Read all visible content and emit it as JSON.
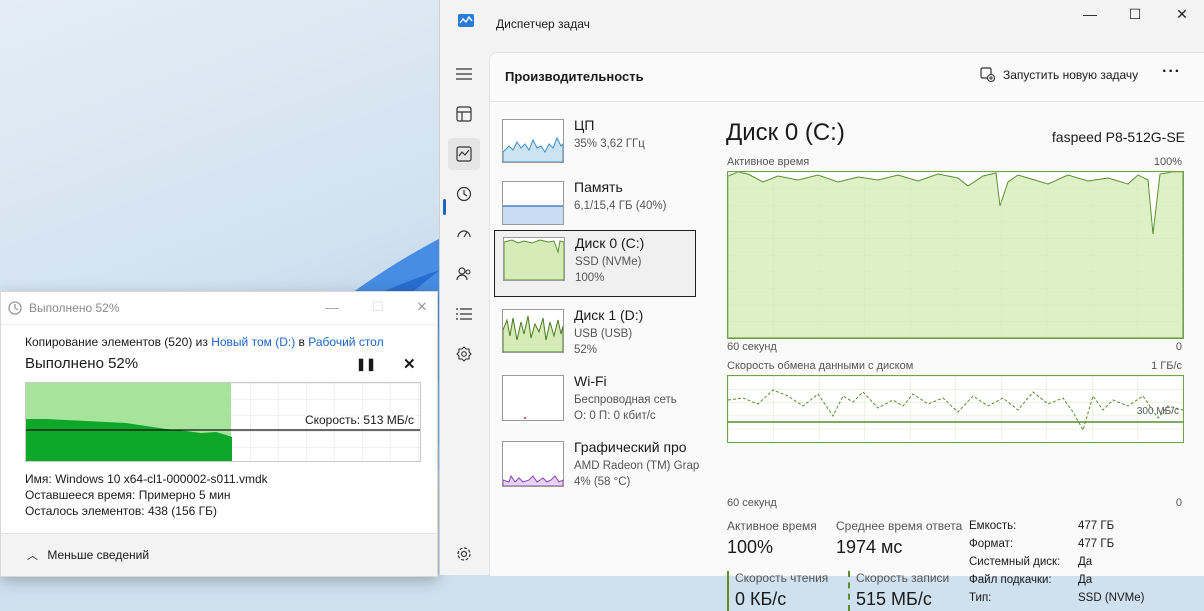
{
  "colors": {
    "accent": "#1a64c8",
    "disk_green": "#6fa14a",
    "copy_green": "#0fa72a"
  },
  "copy_dialog": {
    "title": "Выполнено 52%",
    "line_prefix": "Копирование элементов (520) из",
    "source": "Новый том (D:)",
    "line_mid": "в",
    "dest": "Рабочий стол",
    "progress_text": "Выполнено 52%",
    "progress": 0.52,
    "speed": "Скорость: 513 МБ/с",
    "name_label": "Имя:",
    "name_value": "Windows 10 x64-cl1-000002-s011.vmdk",
    "time_label": "Оставшееся время:",
    "time_value": "Примерно 5 мин",
    "items_label": "Осталось элементов:",
    "items_value": "438 (156 ГБ)",
    "less": "Меньше сведений"
  },
  "task_manager": {
    "app_title": "Диспетчер задач",
    "page_title": "Производительность",
    "run_task": "Запустить новую задачу",
    "nav_icons": [
      "hamburger-icon",
      "processes-icon",
      "performance-icon",
      "history-icon",
      "startup-icon",
      "users-icon",
      "details-icon",
      "services-icon",
      "settings-icon"
    ],
    "devices": [
      {
        "name": "ЦП",
        "d1": "35% 3,62 ГГц",
        "d2": ""
      },
      {
        "name": "Память",
        "d1": "6,1/15,4 ГБ (40%)",
        "d2": ""
      },
      {
        "name": "Диск 0 (C:)",
        "d1": "SSD (NVMe)",
        "d2": "100%"
      },
      {
        "name": "Диск 1 (D:)",
        "d1": "USB (USB)",
        "d2": "52%"
      },
      {
        "name": "Wi-Fi",
        "d1": "Беспроводная сеть",
        "d2": "О: 0 П: 0 кбит/с"
      },
      {
        "name": "Графический про",
        "d1": "AMD Radeon (TM) Grap",
        "d2": "4% (58 °C)"
      }
    ],
    "detail": {
      "title": "Диск 0 (C:)",
      "model": "faspeed P8-512G-SE",
      "chart1_label": "Активное время",
      "chart1_max": "100%",
      "chart1_time": "60 секунд",
      "chart1_min": "0",
      "chart2_label": "Скорость обмена данными с диском",
      "chart2_max": "1 ГБ/с",
      "chart2_time": "60 секунд",
      "chart2_min": "0",
      "chart2_marker": "300 МБ/с",
      "active_label": "Активное время",
      "active_value": "100%",
      "resp_label": "Среднее время ответа",
      "resp_value": "1974 мс",
      "read_label": "Скорость чтения",
      "read_value": "0 КБ/с",
      "write_label": "Скорость записи",
      "write_value": "515 МБ/с",
      "props": [
        {
          "k": "Емкость:",
          "v": "477 ГБ"
        },
        {
          "k": "Формат:",
          "v": "477 ГБ"
        },
        {
          "k": "Системный диск:",
          "v": "Да"
        },
        {
          "k": "Файл подкачки:",
          "v": "Да"
        },
        {
          "k": "Тип:",
          "v": "SSD (NVMe)"
        }
      ]
    }
  }
}
